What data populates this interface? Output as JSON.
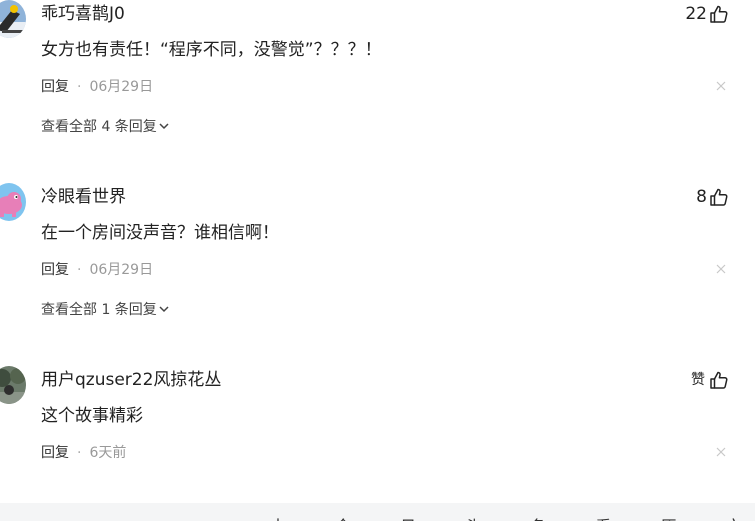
{
  "comments": [
    {
      "username": "乖巧喜鹊J0",
      "text": "女方也有责任！“程序不同，没警觉”？？？！",
      "reply_label": "回复",
      "separator": "·",
      "date": "06月29日",
      "likes": "22",
      "view_all": "查看全部 4 条回复"
    },
    {
      "username": "冷眼看世界",
      "text": "在一个房间没声音？谁相信啊！",
      "reply_label": "回复",
      "separator": "·",
      "date": "06月29日",
      "likes": "8",
      "view_all": "查看全部 1 条回复"
    },
    {
      "username": "用户qzuser22风掠花丛",
      "text": "这个故事精彩",
      "reply_label": "回复",
      "separator": "·",
      "date": "6天前",
      "likes": "赞"
    }
  ],
  "icons": {
    "thumb": "thumb-up-icon",
    "close": "close-icon",
    "chevron": "chevron-down-icon"
  },
  "colors": {
    "text_primary": "#222222",
    "text_meta": "#999999",
    "bottom_bar": "#f4f5f6"
  },
  "bottom_bar": {
    "text": "去 今 日 头 条 看 原 文"
  }
}
